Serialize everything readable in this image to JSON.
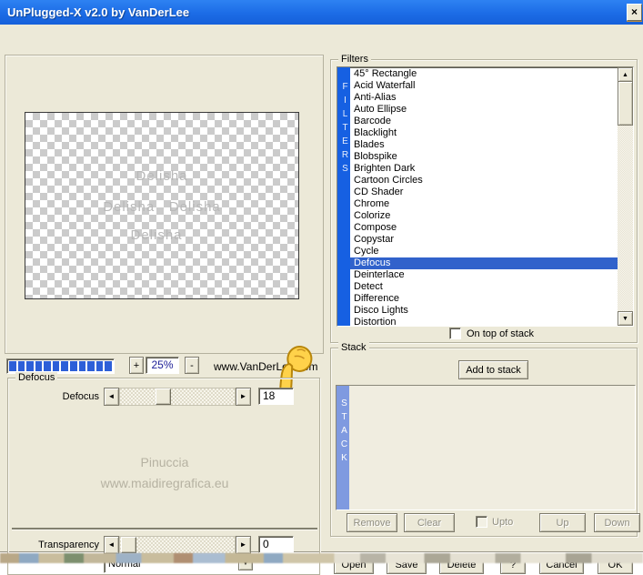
{
  "titlebar": {
    "title": "UnPlugged-X v2.0 by VanDerLee",
    "close_glyph": "×"
  },
  "preview": {
    "watermark_line1": "Delisha",
    "watermark_line2": "Delisha   Delisha",
    "watermark_line3": "Delisha"
  },
  "zoombar": {
    "progress_blocks": 12,
    "plus_label": "+",
    "zoom_level": "25%",
    "minus_label": "-",
    "site_link": "www.VanDerLee.com"
  },
  "defocus_group": {
    "title": "Defocus",
    "slider_label": "Defocus",
    "slider_value": "18",
    "left_arrow": "◄",
    "right_arrow": "►",
    "watermark_name": "Pinuccia",
    "watermark_url": "www.maidiregrafica.eu",
    "transparency_label": "Transparency",
    "transparency_value": "0",
    "blend_mode": "Normal",
    "dropdown_arrow": "▼"
  },
  "filters_group": {
    "title": "Filters",
    "vertical_label": "FILTERS",
    "selected_item": "Defocus",
    "items": [
      "45° Rectangle",
      "Acid Waterfall",
      "Anti-Alias",
      "Auto Ellipse",
      "Barcode",
      "Blacklight",
      "Blades",
      "Blobspike",
      "Brighten Dark",
      "Cartoon Circles",
      "CD Shader",
      "Chrome",
      "Colorize",
      "Compose",
      "Copystar",
      "Cycle",
      "Defocus",
      "Deinterlace",
      "Detect",
      "Difference",
      "Disco Lights",
      "Distortion"
    ],
    "scroll_up": "▲",
    "scroll_down": "▼",
    "on_top_label": "On top of stack"
  },
  "stack_group": {
    "title": "Stack",
    "vertical_label": "STACK",
    "add_button": "Add to stack",
    "remove_button": "Remove",
    "clear_button": "Clear",
    "upto_label": "Upto",
    "up_button": "Up",
    "down_button": "Down"
  },
  "action_buttons": {
    "open": "Open",
    "save": "Save",
    "delete": "Delete",
    "help": "?",
    "cancel": "Cancel",
    "ok": "OK"
  },
  "colors": {
    "titlebar_blue": "#1c6ce6",
    "dialog_bg": "#ece9d8",
    "selection_blue": "#3162cb",
    "filters_strip_blue": "#1660e2",
    "stack_strip_blue": "#7f9ae0",
    "progress_block_blue": "#2d5fd8",
    "zoom_text_navy": "#1f2098"
  }
}
